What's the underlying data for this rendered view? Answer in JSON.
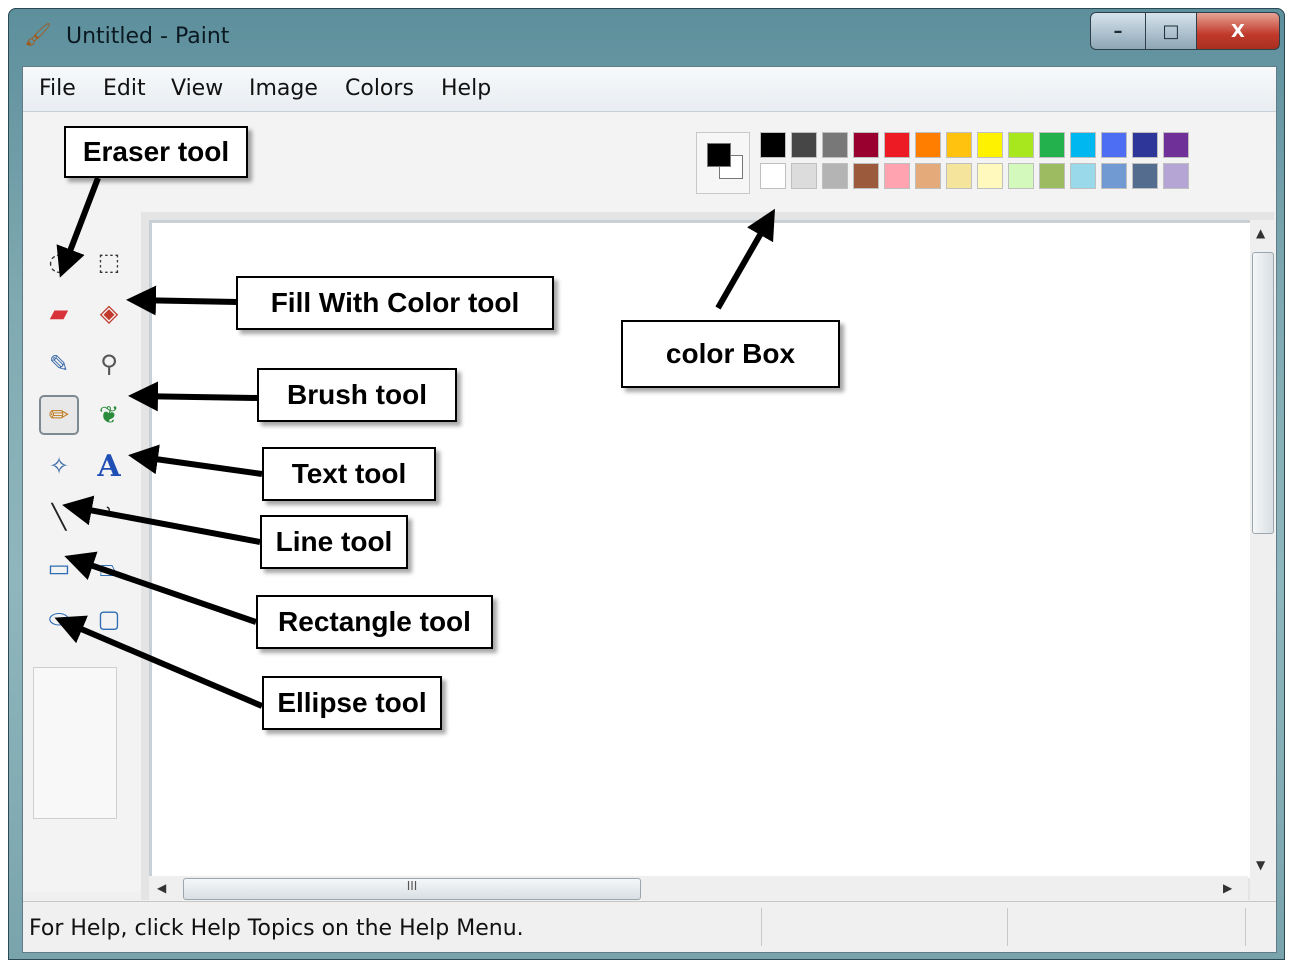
{
  "window": {
    "title": "Untitled - Paint",
    "icon": "paint-app-icon",
    "controls": {
      "minimize": "–",
      "maximize": "□",
      "close": "X"
    }
  },
  "menu": [
    "File",
    "Edit",
    "View",
    "Image",
    "Colors",
    "Help"
  ],
  "palette": {
    "top_row": [
      "#000000",
      "#464646",
      "#787878",
      "#990030",
      "#ed1c24",
      "#ff7e00",
      "#ffc20e",
      "#fff200",
      "#a8e61d",
      "#22b14c",
      "#00b7ef",
      "#4d6df3",
      "#2f3699",
      "#6f3198"
    ],
    "bottom_row": [
      "#ffffff",
      "#dcdcdc",
      "#b4b4b4",
      "#9c5a3c",
      "#ffa3b1",
      "#e5aa7a",
      "#f5e49c",
      "#fff9bd",
      "#d3f9bc",
      "#9dbb61",
      "#99d9ea",
      "#709ad1",
      "#546d8e",
      "#b5a5d5"
    ],
    "current_fg": "#000000",
    "current_bg": "#ffffff"
  },
  "tools": [
    {
      "name": "free-form-select-icon",
      "glyph": "◌"
    },
    {
      "name": "select-icon",
      "glyph": "⬚"
    },
    {
      "name": "eraser-icon",
      "glyph": "▰"
    },
    {
      "name": "fill-icon",
      "glyph": "◈"
    },
    {
      "name": "pick-color-icon",
      "glyph": "✎"
    },
    {
      "name": "magnifier-icon",
      "glyph": "⚲"
    },
    {
      "name": "pencil-icon",
      "glyph": "✏"
    },
    {
      "name": "brush-icon",
      "glyph": "❦"
    },
    {
      "name": "airbrush-icon",
      "glyph": "✧"
    },
    {
      "name": "text-icon",
      "glyph": "A"
    },
    {
      "name": "line-icon",
      "glyph": "╲"
    },
    {
      "name": "curve-icon",
      "glyph": "ʾ"
    },
    {
      "name": "rectangle-icon",
      "glyph": "▭"
    },
    {
      "name": "polygon-icon",
      "glyph": "⏢"
    },
    {
      "name": "ellipse-icon",
      "glyph": "⬭"
    },
    {
      "name": "rounded-rectangle-icon",
      "glyph": "▢"
    }
  ],
  "callouts": {
    "eraser": "Eraser tool",
    "fill": "Fill With Color tool",
    "color_box": "color Box",
    "brush": "Brush tool",
    "text": "Text tool",
    "line": "Line tool",
    "rectangle": "Rectangle tool",
    "ellipse": "Ellipse tool"
  },
  "scroll": {
    "up": "▲",
    "down": "▼",
    "left": "◀",
    "right": "▶",
    "grip": "III"
  },
  "status": {
    "text": "For Help, click Help Topics on the Help Menu."
  }
}
